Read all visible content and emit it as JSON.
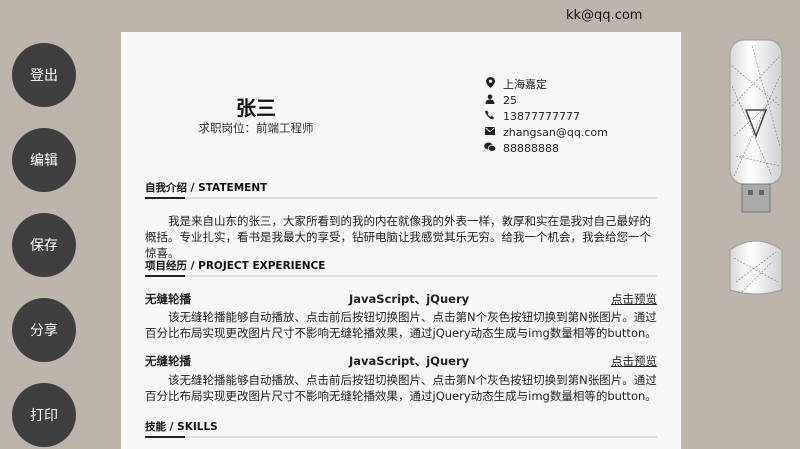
{
  "header": {
    "user_email": "kk@qq.com"
  },
  "sidebar": {
    "buttons": [
      "登出",
      "编辑",
      "保存",
      "分享",
      "打印"
    ]
  },
  "resume": {
    "name": "张三",
    "position": "求职岗位：前端工程师",
    "contacts": {
      "location": "上海嘉定",
      "age": "25",
      "phone": "13877777777",
      "email": "zhangsan@qq.com",
      "wechat": "88888888"
    },
    "sections": {
      "statement": {
        "title": "自我介绍 / STATEMENT",
        "text": "我是来自山东的张三，大家所看到的我的内在就像我的外表一样，敦厚和实在是我对自己最好的概括。专业扎实，看书是我最大的享受，钻研电脑让我感觉其乐无穷。给我一个机会，我会给您一个惊喜。"
      },
      "experience": {
        "title": "项目经历 / PROJECT EXPERIENCE",
        "projects": [
          {
            "name": "无缝轮播",
            "tech": "JavaScript、jQuery",
            "link": "点击预览",
            "desc": "该无缝轮播能够自动播放、点击前后按钮切换图片、点击第N个灰色按钮切换到第N张图片。通过百分比布局实现更改图片尺寸不影响无缝轮播效果，通过jQuery动态生成与img数量相等的button。"
          },
          {
            "name": "无缝轮播",
            "tech": "JavaScript、jQuery",
            "link": "点击预览",
            "desc": "该无缝轮播能够自动播放、点击前后按钮切换图片、点击第N个灰色按钮切换到第N张图片。通过百分比布局实现更改图片尺寸不影响无缝轮播效果，通过jQuery动态生成与img数量相等的button。"
          }
        ]
      },
      "skills": {
        "title": "技能 / SKILLS"
      }
    }
  }
}
